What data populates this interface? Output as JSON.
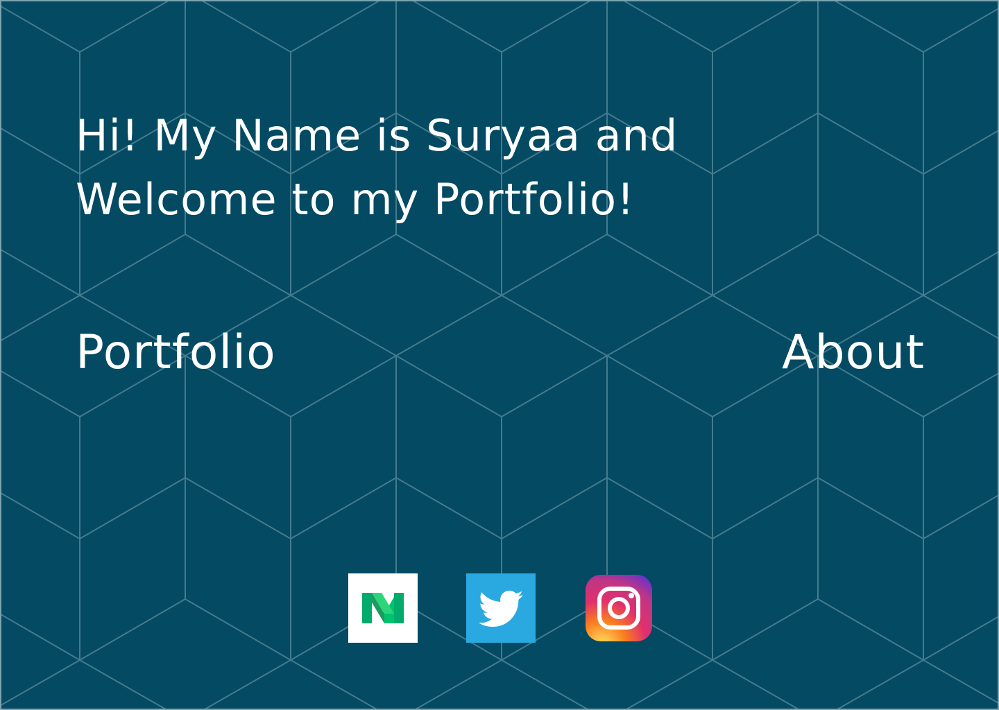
{
  "hero": {
    "line1": "Hi! My Name is Suryaa and",
    "line2": "Welcome to my Portfolio!"
  },
  "nav": {
    "portfolio": "Portfolio",
    "about": "About"
  },
  "social": [
    {
      "icon": "medium-icon",
      "color": "#00ab6c"
    },
    {
      "icon": "twitter-icon",
      "color": "#2aa9e0"
    },
    {
      "icon": "instagram-icon",
      "color": "#e1306c"
    }
  ],
  "colors": {
    "background": "#034a62",
    "pattern_lines": "#5b8b9c",
    "text": "#ffffff"
  }
}
